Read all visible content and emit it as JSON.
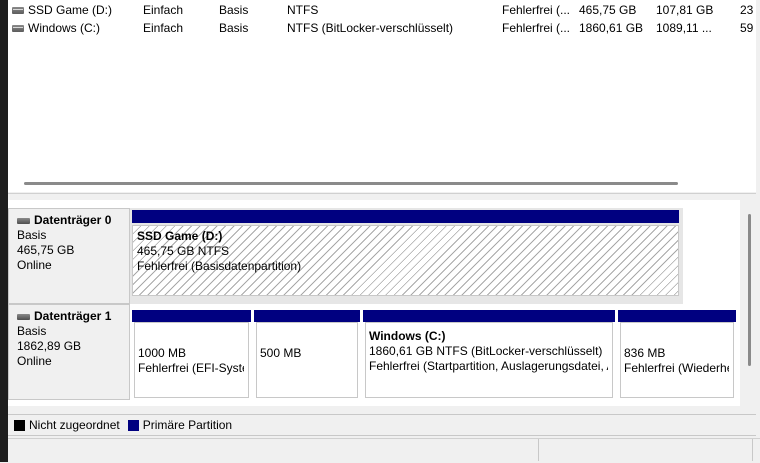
{
  "volumes": [
    {
      "name": "SSD Game (D:)",
      "layout": "Einfach",
      "type": "Basis",
      "fs": "NTFS",
      "status": "Fehlerfrei (...",
      "capacity": "465,75 GB",
      "free": "107,81 GB",
      "pct": "23"
    },
    {
      "name": "Windows (C:)",
      "layout": "Einfach",
      "type": "Basis",
      "fs": "NTFS (BitLocker-verschlüsselt)",
      "status": "Fehlerfrei (...",
      "capacity": "1860,61 GB",
      "free": "1089,11 ...",
      "pct": "59"
    }
  ],
  "disks": [
    {
      "name": "Datenträger 0",
      "type": "Basis",
      "size": "465,75 GB",
      "state": "Online",
      "partitions": [
        {
          "title": "SSD Game  (D:)",
          "line1": "465,75 GB NTFS",
          "line2": "Fehlerfrei (Basisdatenpartition)"
        }
      ]
    },
    {
      "name": "Datenträger 1",
      "type": "Basis",
      "size": "1862,89 GB",
      "state": "Online",
      "partitions": [
        {
          "line1": "1000 MB",
          "line2": "Fehlerfrei (EFI-Syster"
        },
        {
          "line1": "500 MB"
        },
        {
          "title": "Windows  (C:)",
          "line1": "1860,61 GB NTFS (BitLocker-verschlüsselt)",
          "line2": "Fehlerfrei (Startpartition, Auslagerungsdatei, A"
        },
        {
          "line1": "836 MB",
          "line2": "Fehlerfrei (Wiederhe"
        }
      ]
    }
  ],
  "legend": [
    {
      "label": "Nicht zugeordnet",
      "color": "#000000"
    },
    {
      "label": "Primäre Partition",
      "color": "#000080"
    }
  ],
  "colors": {
    "primary": "#000080",
    "unallocated": "#000000"
  }
}
